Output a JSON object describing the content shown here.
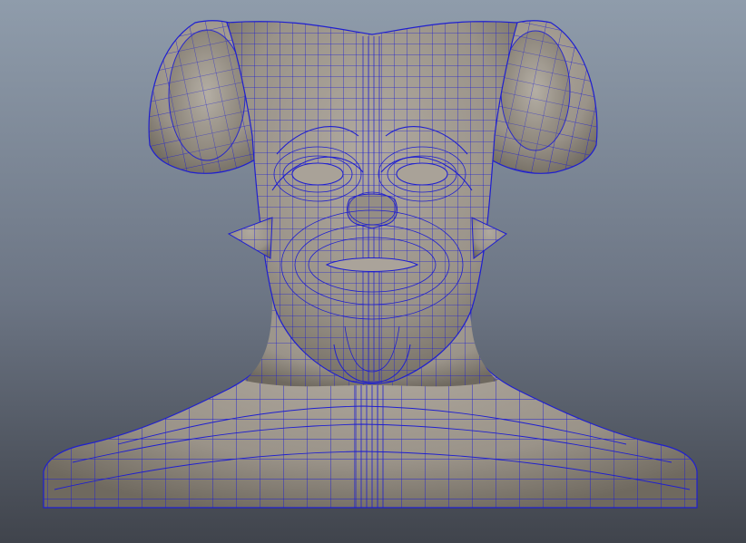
{
  "viewport": {
    "content": "wireframe-sculpt-bust",
    "background_top": "#8d9aa8",
    "background_mid": "#6b7584",
    "background_bottom": "#3f434b",
    "mesh_fill": "#9b948a",
    "mesh_shadow": "#6e685f",
    "wire_color": "#1f1fd0"
  }
}
